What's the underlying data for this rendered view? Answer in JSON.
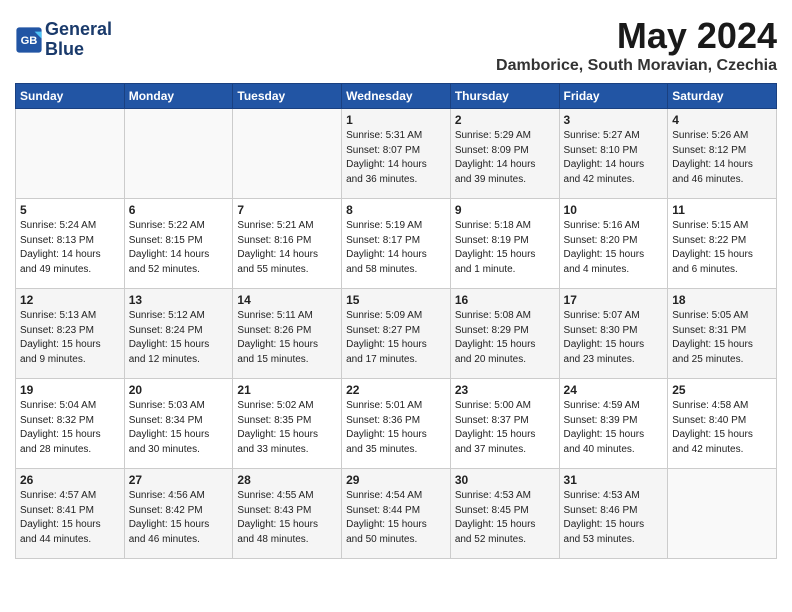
{
  "header": {
    "logo_line1": "General",
    "logo_line2": "Blue",
    "month_year": "May 2024",
    "location": "Damborice, South Moravian, Czechia"
  },
  "weekdays": [
    "Sunday",
    "Monday",
    "Tuesday",
    "Wednesday",
    "Thursday",
    "Friday",
    "Saturday"
  ],
  "weeks": [
    [
      {
        "day": "",
        "info": ""
      },
      {
        "day": "",
        "info": ""
      },
      {
        "day": "",
        "info": ""
      },
      {
        "day": "1",
        "info": "Sunrise: 5:31 AM\nSunset: 8:07 PM\nDaylight: 14 hours\nand 36 minutes."
      },
      {
        "day": "2",
        "info": "Sunrise: 5:29 AM\nSunset: 8:09 PM\nDaylight: 14 hours\nand 39 minutes."
      },
      {
        "day": "3",
        "info": "Sunrise: 5:27 AM\nSunset: 8:10 PM\nDaylight: 14 hours\nand 42 minutes."
      },
      {
        "day": "4",
        "info": "Sunrise: 5:26 AM\nSunset: 8:12 PM\nDaylight: 14 hours\nand 46 minutes."
      }
    ],
    [
      {
        "day": "5",
        "info": "Sunrise: 5:24 AM\nSunset: 8:13 PM\nDaylight: 14 hours\nand 49 minutes."
      },
      {
        "day": "6",
        "info": "Sunrise: 5:22 AM\nSunset: 8:15 PM\nDaylight: 14 hours\nand 52 minutes."
      },
      {
        "day": "7",
        "info": "Sunrise: 5:21 AM\nSunset: 8:16 PM\nDaylight: 14 hours\nand 55 minutes."
      },
      {
        "day": "8",
        "info": "Sunrise: 5:19 AM\nSunset: 8:17 PM\nDaylight: 14 hours\nand 58 minutes."
      },
      {
        "day": "9",
        "info": "Sunrise: 5:18 AM\nSunset: 8:19 PM\nDaylight: 15 hours\nand 1 minute."
      },
      {
        "day": "10",
        "info": "Sunrise: 5:16 AM\nSunset: 8:20 PM\nDaylight: 15 hours\nand 4 minutes."
      },
      {
        "day": "11",
        "info": "Sunrise: 5:15 AM\nSunset: 8:22 PM\nDaylight: 15 hours\nand 6 minutes."
      }
    ],
    [
      {
        "day": "12",
        "info": "Sunrise: 5:13 AM\nSunset: 8:23 PM\nDaylight: 15 hours\nand 9 minutes."
      },
      {
        "day": "13",
        "info": "Sunrise: 5:12 AM\nSunset: 8:24 PM\nDaylight: 15 hours\nand 12 minutes."
      },
      {
        "day": "14",
        "info": "Sunrise: 5:11 AM\nSunset: 8:26 PM\nDaylight: 15 hours\nand 15 minutes."
      },
      {
        "day": "15",
        "info": "Sunrise: 5:09 AM\nSunset: 8:27 PM\nDaylight: 15 hours\nand 17 minutes."
      },
      {
        "day": "16",
        "info": "Sunrise: 5:08 AM\nSunset: 8:29 PM\nDaylight: 15 hours\nand 20 minutes."
      },
      {
        "day": "17",
        "info": "Sunrise: 5:07 AM\nSunset: 8:30 PM\nDaylight: 15 hours\nand 23 minutes."
      },
      {
        "day": "18",
        "info": "Sunrise: 5:05 AM\nSunset: 8:31 PM\nDaylight: 15 hours\nand 25 minutes."
      }
    ],
    [
      {
        "day": "19",
        "info": "Sunrise: 5:04 AM\nSunset: 8:32 PM\nDaylight: 15 hours\nand 28 minutes."
      },
      {
        "day": "20",
        "info": "Sunrise: 5:03 AM\nSunset: 8:34 PM\nDaylight: 15 hours\nand 30 minutes."
      },
      {
        "day": "21",
        "info": "Sunrise: 5:02 AM\nSunset: 8:35 PM\nDaylight: 15 hours\nand 33 minutes."
      },
      {
        "day": "22",
        "info": "Sunrise: 5:01 AM\nSunset: 8:36 PM\nDaylight: 15 hours\nand 35 minutes."
      },
      {
        "day": "23",
        "info": "Sunrise: 5:00 AM\nSunset: 8:37 PM\nDaylight: 15 hours\nand 37 minutes."
      },
      {
        "day": "24",
        "info": "Sunrise: 4:59 AM\nSunset: 8:39 PM\nDaylight: 15 hours\nand 40 minutes."
      },
      {
        "day": "25",
        "info": "Sunrise: 4:58 AM\nSunset: 8:40 PM\nDaylight: 15 hours\nand 42 minutes."
      }
    ],
    [
      {
        "day": "26",
        "info": "Sunrise: 4:57 AM\nSunset: 8:41 PM\nDaylight: 15 hours\nand 44 minutes."
      },
      {
        "day": "27",
        "info": "Sunrise: 4:56 AM\nSunset: 8:42 PM\nDaylight: 15 hours\nand 46 minutes."
      },
      {
        "day": "28",
        "info": "Sunrise: 4:55 AM\nSunset: 8:43 PM\nDaylight: 15 hours\nand 48 minutes."
      },
      {
        "day": "29",
        "info": "Sunrise: 4:54 AM\nSunset: 8:44 PM\nDaylight: 15 hours\nand 50 minutes."
      },
      {
        "day": "30",
        "info": "Sunrise: 4:53 AM\nSunset: 8:45 PM\nDaylight: 15 hours\nand 52 minutes."
      },
      {
        "day": "31",
        "info": "Sunrise: 4:53 AM\nSunset: 8:46 PM\nDaylight: 15 hours\nand 53 minutes."
      },
      {
        "day": "",
        "info": ""
      }
    ]
  ]
}
